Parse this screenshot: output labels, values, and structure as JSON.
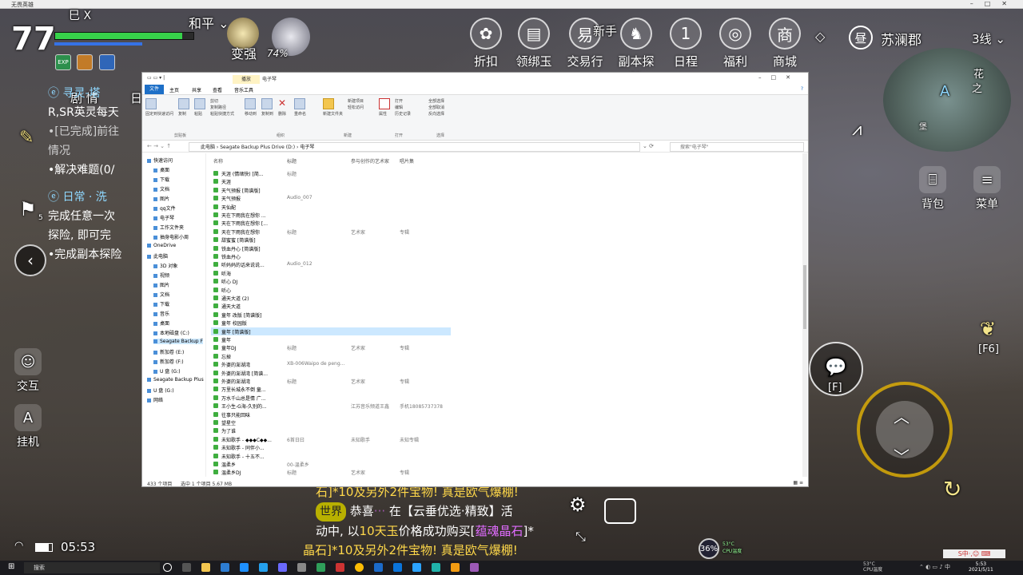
{
  "window_title": "无畏英雄",
  "game": {
    "level": "77",
    "player_name": "巳 X",
    "hp_fraction": 0.92,
    "mp_fraction": 0.63,
    "buffs": [
      "EXP",
      "",
      ""
    ],
    "mode": "和平",
    "strengthen_label": "变强",
    "pet_percent": "74%",
    "top_icons": [
      {
        "name": "折扣",
        "icon": "gift-icon"
      },
      {
        "name": "领绑玉",
        "icon": "coupon-icon"
      },
      {
        "name": "交易行",
        "icon": "trade-icon"
      },
      {
        "name": "副本探险",
        "icon": "demon-icon"
      },
      {
        "name": "日程",
        "icon": "calendar-icon"
      },
      {
        "name": "福利",
        "icon": "spiral-icon"
      },
      {
        "name": "商城",
        "icon": "shop-icon"
      }
    ],
    "new_badge": "新手",
    "calendar_day": "1",
    "time_of_day": "昼",
    "region": "苏澜郡",
    "line": "3线",
    "map_label_1": "花",
    "map_label_2": "之",
    "map_label_3": "堡",
    "map_label_4": "A",
    "quest_tabs": [
      "剧 情",
      "日"
    ],
    "quests": [
      {
        "title": "寻灵-塔",
        "lines": [
          "R,SR英灵每天",
          "•[已完成]前往",
          "  情况",
          "•解决难题(0/"
        ]
      },
      {
        "title": "日常 · 洗",
        "lines": [
          "完成任意一次",
          "探险, 即可完",
          "•完成副本探险"
        ]
      }
    ],
    "left_buttons": [
      "交互",
      "挂机"
    ],
    "flag_count": "5",
    "right_buttons": [
      "背包",
      "菜单"
    ],
    "f_label": "[F]",
    "f6_label": "[F6]",
    "chat": {
      "line1": "石]*10及另外2件宝物! 真是欧气爆棚!",
      "world_tag": "世界",
      "line2_a": "恭喜",
      "line2_b": "在【云垂优选·精致】活",
      "line3_a": "动中, 以",
      "line3_b": "10天玉",
      "line3_c": "价格成功购买[",
      "line3_d": "蕴魂晶石",
      "line3_e": "]*",
      "line4": "晶石]*10及另外2件宝物! 真是欧气爆棚!"
    },
    "clock": "05:53",
    "perf_percent": "36%",
    "perf_temp": "53°C",
    "perf_label": "CPU温度"
  },
  "explorer": {
    "title_tab": "播放",
    "title_name": "电子琴",
    "ribbon_tabs": [
      "文件",
      "主页",
      "共享",
      "查看",
      "音乐工具"
    ],
    "ribbon_groups": [
      {
        "label": "剪贴板",
        "items": [
          "固定到快速访问",
          "复制",
          "粘贴",
          "剪切",
          "复制路径",
          "粘贴快捷方式"
        ]
      },
      {
        "label": "组织",
        "items": [
          "移动到",
          "复制到",
          "删除",
          "重命名"
        ]
      },
      {
        "label": "新建",
        "items": [
          "新建文件夹",
          "新建项目",
          "轻松访问"
        ]
      },
      {
        "label": "打开",
        "items": [
          "属性",
          "打开",
          "编辑",
          "历史记录"
        ]
      },
      {
        "label": "选择",
        "items": [
          "全部选择",
          "全部取消",
          "反向选择"
        ]
      }
    ],
    "path": [
      "此电脑",
      "Seagate Backup Plus Drive (D:)",
      "电子琴"
    ],
    "search_placeholder": "搜索\"电子琴\"",
    "columns": [
      "名称",
      "标题",
      "参与创作的艺术家",
      "唱片集"
    ],
    "nav": [
      {
        "label": "快速访问",
        "indent": 0
      },
      {
        "label": "桌面",
        "indent": 1
      },
      {
        "label": "下载",
        "indent": 1
      },
      {
        "label": "文档",
        "indent": 1
      },
      {
        "label": "图片",
        "indent": 1
      },
      {
        "label": "qq文件",
        "indent": 1
      },
      {
        "label": "电子琴",
        "indent": 1
      },
      {
        "label": "工作文件夹",
        "indent": 1
      },
      {
        "label": "抽身电影小周",
        "indent": 1
      },
      {
        "label": "OneDrive",
        "indent": 0
      },
      {
        "label": "此电脑",
        "indent": 0
      },
      {
        "label": "3D 对象",
        "indent": 1
      },
      {
        "label": "视频",
        "indent": 1
      },
      {
        "label": "图片",
        "indent": 1
      },
      {
        "label": "文档",
        "indent": 1
      },
      {
        "label": "下载",
        "indent": 1
      },
      {
        "label": "音乐",
        "indent": 1
      },
      {
        "label": "桌面",
        "indent": 1
      },
      {
        "label": "本地磁盘 (C:)",
        "indent": 1
      },
      {
        "label": "Seagate Backup F",
        "indent": 1
      },
      {
        "label": "新加卷 (E:)",
        "indent": 1
      },
      {
        "label": "新加卷 (F:)",
        "indent": 1
      },
      {
        "label": "U 盘 (G:)",
        "indent": 1
      },
      {
        "label": "Seagate Backup Plus",
        "indent": 0
      },
      {
        "label": "U 盘 (G:)",
        "indent": 0
      },
      {
        "label": "网络",
        "indent": 0
      }
    ],
    "files": [
      {
        "name": "天涯 (情绪快) [简...",
        "title": "标题",
        "artist": "",
        "album": ""
      },
      {
        "name": "天涯",
        "title": "",
        "artist": "",
        "album": ""
      },
      {
        "name": "天气预报 [简谱版]",
        "title": "",
        "artist": "",
        "album": ""
      },
      {
        "name": "天气预报",
        "title": "Audio_007",
        "artist": "",
        "album": ""
      },
      {
        "name": "天仙配",
        "title": "",
        "artist": "",
        "album": ""
      },
      {
        "name": "天在下雨我在想你 ...",
        "title": "",
        "artist": "",
        "album": ""
      },
      {
        "name": "天在下雨我在想你 [...",
        "title": "",
        "artist": "",
        "album": ""
      },
      {
        "name": "天在下雨我在想你",
        "title": "标题",
        "artist": "艺术家",
        "album": "专辑"
      },
      {
        "name": "甜蜜蜜 [简谱版]",
        "title": "",
        "artist": "",
        "album": ""
      },
      {
        "name": "铁血丹心 [简谱版]",
        "title": "",
        "artist": "",
        "album": ""
      },
      {
        "name": "铁血丹心",
        "title": "",
        "artist": "",
        "album": ""
      },
      {
        "name": "听妈妈的话来说说...",
        "title": "Audio_012",
        "artist": "",
        "album": ""
      },
      {
        "name": "听海",
        "title": "",
        "artist": "",
        "album": ""
      },
      {
        "name": "听心 DJ",
        "title": "",
        "artist": "",
        "album": ""
      },
      {
        "name": "听心",
        "title": "",
        "artist": "",
        "album": ""
      },
      {
        "name": "通天大道 (2)",
        "title": "",
        "artist": "",
        "album": ""
      },
      {
        "name": "通天大道",
        "title": "",
        "artist": "",
        "album": ""
      },
      {
        "name": "童年 改版 [简谱版]",
        "title": "",
        "artist": "",
        "album": ""
      },
      {
        "name": "童年 校园版",
        "title": "",
        "artist": "",
        "album": ""
      },
      {
        "name": "童年 [简谱版]",
        "title": "",
        "artist": "",
        "album": "",
        "selected": true
      },
      {
        "name": "童年",
        "title": "",
        "artist": "",
        "album": ""
      },
      {
        "name": "童年DJ",
        "title": "标题",
        "artist": "艺术家",
        "album": "专辑"
      },
      {
        "name": "忘掉",
        "title": "",
        "artist": "",
        "album": ""
      },
      {
        "name": "外婆的澎湖湾",
        "title": "XB-006Waipo de peng...",
        "artist": "",
        "album": ""
      },
      {
        "name": "外婆的澎湖湾 [简谱...",
        "title": "",
        "artist": "",
        "album": ""
      },
      {
        "name": "外婆的澎湖湾",
        "title": "标题",
        "artist": "艺术家",
        "album": "专辑"
      },
      {
        "name": "万里长城永不倒 童...",
        "title": "",
        "artist": "",
        "album": ""
      },
      {
        "name": "万水千山总是情 广...",
        "title": "",
        "artist": "",
        "album": ""
      },
      {
        "name": "王小生-G海-久别的...",
        "title": "",
        "artist": "江苏音乐频道王鑫",
        "album": "手机18085737378"
      },
      {
        "name": "往事只能回味",
        "title": "",
        "artist": "",
        "album": ""
      },
      {
        "name": "望星空",
        "title": "",
        "artist": "",
        "album": ""
      },
      {
        "name": "为了谁",
        "title": "",
        "artist": "",
        "album": ""
      },
      {
        "name": "未知歌手 - ◆◆◆C◆◆...",
        "title": "6首日曰",
        "artist": "未知歌手",
        "album": "未知专辑"
      },
      {
        "name": "未知歌手 - 同伴小...",
        "title": "",
        "artist": "",
        "album": ""
      },
      {
        "name": "未知歌手 - 十五不...",
        "title": "",
        "artist": "",
        "album": ""
      },
      {
        "name": "温柔乡",
        "title": "00-温柔乡",
        "artist": "",
        "album": ""
      },
      {
        "name": "温柔乡DJ",
        "title": "标题",
        "artist": "艺术家",
        "album": "专辑"
      }
    ],
    "status_count": "433 个项目",
    "status_selection": "选中 1 个项目 5.67 MB"
  },
  "taskbar": {
    "search_placeholder": "搜索",
    "cpu_line1": "53°C",
    "cpu_line2": "CPU温度",
    "clock_time": "5:53",
    "clock_date": "2021/5/11",
    "ime": "S中·,☺ ⌨"
  }
}
